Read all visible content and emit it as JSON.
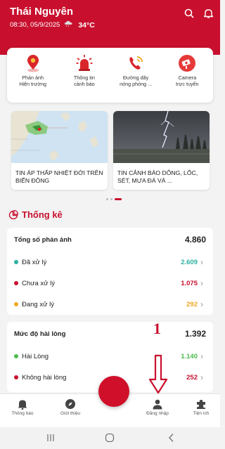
{
  "header": {
    "city": "Thái Nguyên",
    "datetime": "08:30, 05/9/2025",
    "weather_icon": "cloud-rain-icon",
    "temperature": "34°C"
  },
  "quick_actions": [
    {
      "label_line1": "Phản ánh",
      "label_line2": "Hiện trường",
      "icon": "map-pin-icon"
    },
    {
      "label_line1": "Thông tin",
      "label_line2": "cảnh báo",
      "icon": "siren-icon"
    },
    {
      "label_line1": "Đường dây",
      "label_line2": "nóng phòng ...",
      "icon": "phone-ring-icon"
    },
    {
      "label_line1": "Camera",
      "label_line2": "trực tuyến",
      "icon": "camera-icon"
    }
  ],
  "news": [
    {
      "title": "TIN ÁP THẤP NHIỆT ĐỚI TRÊN BIỂN ĐÔNG"
    },
    {
      "title": "TIN CẢNH BÁO DÔNG, LỐC, SÉT, MƯA ĐÁ VÀ ..."
    }
  ],
  "stats": {
    "title": "Thống kê",
    "reports": {
      "header_label": "Tổng số phản ánh",
      "header_value": "4.860",
      "rows": [
        {
          "label": "Đã xử lý",
          "value": "2.609",
          "color": "#2bb0a0"
        },
        {
          "label": "Chưa xử lý",
          "value": "1.075",
          "color": "#c8102e"
        },
        {
          "label": "Đang xử lý",
          "value": "292",
          "color": "#f0a820"
        }
      ]
    },
    "satisfaction": {
      "header_label": "Mức độ hài lòng",
      "header_value": "1.392",
      "rows": [
        {
          "label": "Hài Lòng",
          "value": "1.140",
          "color": "#4cbb4c"
        },
        {
          "label": "Không hài lòng",
          "value": "252",
          "color": "#c8102e"
        }
      ]
    }
  },
  "annotation": {
    "number": "1"
  },
  "tabbar": [
    {
      "label": "Thông báo",
      "icon": "bell-icon"
    },
    {
      "label": "Giới thiệu",
      "icon": "compass-icon"
    },
    {
      "label": "Đăng nhập",
      "icon": "user-icon"
    },
    {
      "label": "Tiện ích",
      "icon": "puzzle-icon"
    }
  ],
  "colors": {
    "brand": "#c8102e",
    "annotation": "#c8102e"
  }
}
